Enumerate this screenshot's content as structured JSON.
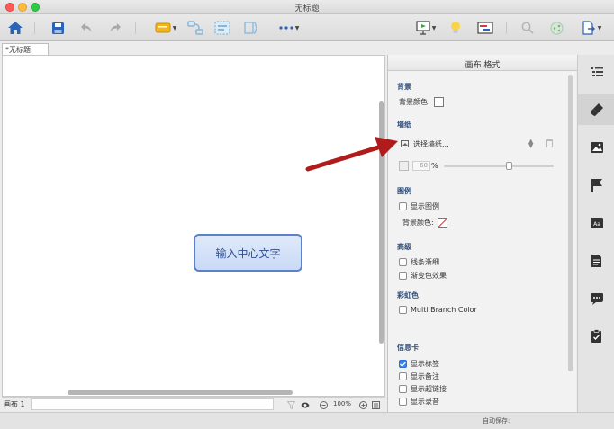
{
  "window": {
    "title": "无标题"
  },
  "document": {
    "tab_label": "*无标题",
    "sheet_label": "画布 1",
    "zoom": "100%"
  },
  "canvas": {
    "central_topic": "输入中心文字"
  },
  "panel": {
    "title": "画布 格式",
    "background": {
      "heading": "背景",
      "color_label": "背景颜色:"
    },
    "wallpaper": {
      "heading": "墙纸",
      "select_label": "选择墙纸...",
      "opacity_value": "60",
      "opacity_unit": "%",
      "opacity_percent": 60
    },
    "legend": {
      "heading": "图例",
      "show_label": "显示图例",
      "color_label": "背景颜色:"
    },
    "advanced": {
      "heading": "高级",
      "taper_label": "线条渐细",
      "gradient_label": "渐变色效果"
    },
    "rainbow": {
      "heading": "彩虹色",
      "multi_branch_label": "Multi Branch Color"
    },
    "info_card": {
      "heading": "信息卡",
      "items": [
        {
          "label": "显示标签",
          "checked": true
        },
        {
          "label": "显示备注",
          "checked": false
        },
        {
          "label": "显示超链接",
          "checked": false
        },
        {
          "label": "显示录音",
          "checked": false
        }
      ]
    }
  },
  "status": {
    "autosave_label": "自动保存:"
  },
  "colors": {
    "accent": "#5b82c9",
    "arrow": "#b01c1c",
    "checkbox_on": "#3d84e6"
  }
}
